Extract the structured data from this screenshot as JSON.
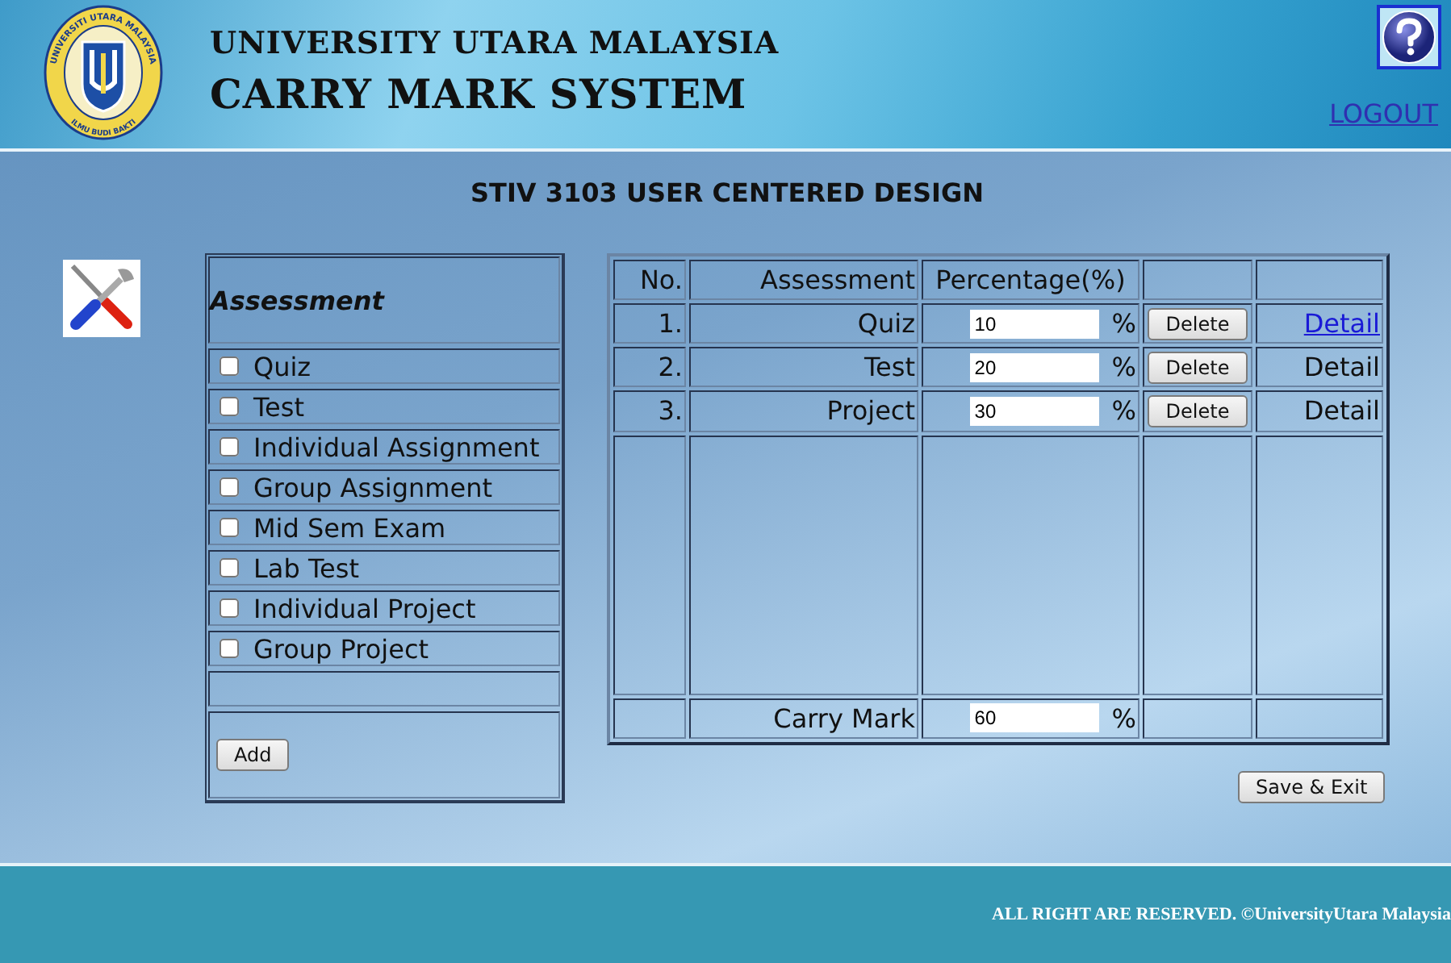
{
  "header": {
    "logo": {
      "ring_text": "UNIVERSITI UTARA MALAYSIA",
      "motto": "ILMU BUDI BAKTI"
    },
    "university": "UNIVERSITY UTARA MALAYSIA",
    "system": "CARRY MARK SYSTEM",
    "logout": "LOGOUT"
  },
  "course_title": "STIV 3103 USER CENTERED DESIGN",
  "assessment_panel": {
    "heading": "Assessment",
    "items": [
      {
        "label": "Quiz",
        "checked": false
      },
      {
        "label": "Test",
        "checked": false
      },
      {
        "label": "Individual Assignment",
        "checked": false
      },
      {
        "label": "Group Assignment",
        "checked": false
      },
      {
        "label": "Mid Sem Exam",
        "checked": false
      },
      {
        "label": "Lab Test",
        "checked": false
      },
      {
        "label": "Individual Project",
        "checked": false
      },
      {
        "label": "Group Project",
        "checked": false
      }
    ],
    "add_button": "Add"
  },
  "table": {
    "columns": [
      "No.",
      "Assessment",
      "Percentage(%)"
    ],
    "rows": [
      {
        "no": "1.",
        "assessment": "Quiz",
        "percentage": "10",
        "unit": "%",
        "delete": "Delete",
        "detail": {
          "label": "Detail",
          "kind": "link"
        }
      },
      {
        "no": "2.",
        "assessment": "Test",
        "percentage": "20",
        "unit": "%",
        "delete": "Delete",
        "detail": {
          "label": "Detail",
          "kind": "text"
        }
      },
      {
        "no": "3.",
        "assessment": "Project",
        "percentage": "30",
        "unit": "%",
        "delete": "Delete",
        "detail": {
          "label": "Detail",
          "kind": "text"
        }
      }
    ],
    "total": {
      "label": "Carry Mark",
      "value": "60",
      "unit": "%"
    }
  },
  "save_button": "Save & Exit",
  "footer": "ALL RIGHT ARE RESERVED. ©UniversityUtara Malaysia"
}
